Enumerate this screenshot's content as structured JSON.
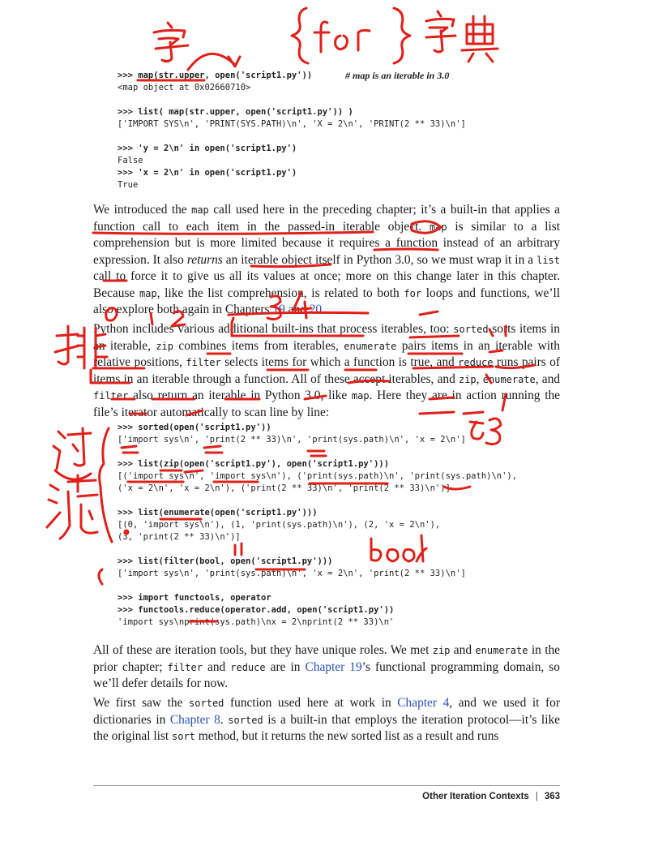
{
  "code_block_1": {
    "lines": [
      {
        "kind": "cmd",
        "text": ">>> map(str.upper, open('script1.py'))",
        "comment": "# map is an iterable in 3.0"
      },
      {
        "kind": "out",
        "text": "<map object at 0x02660710>"
      },
      {
        "kind": "gap"
      },
      {
        "kind": "cmd",
        "text": ">>> list( map(str.upper, open('script1.py')) )"
      },
      {
        "kind": "out",
        "text": "['IMPORT SYS\\n', 'PRINT(SYS.PATH)\\n', 'X = 2\\n', 'PRINT(2 ** 33)\\n']"
      },
      {
        "kind": "gap"
      },
      {
        "kind": "cmd",
        "text": ">>> 'y = 2\\n' in open('script1.py')"
      },
      {
        "kind": "out",
        "text": "False"
      },
      {
        "kind": "cmd",
        "text": ">>> 'x = 2\\n' in open('script1.py')"
      },
      {
        "kind": "out",
        "text": "True"
      }
    ]
  },
  "paragraph_1": [
    {
      "t": "text",
      "v": "We introduced the "
    },
    {
      "t": "mono",
      "v": "map"
    },
    {
      "t": "text",
      "v": " call used here in the preceding chapter; it’s a built-in that applies a function call to each item in the passed-in iterable object. "
    },
    {
      "t": "mono",
      "v": "map"
    },
    {
      "t": "text",
      "v": " is similar to a list comprehension but is more limited because it requires a function instead of an arbitrary expression. It also "
    },
    {
      "t": "em",
      "v": "returns"
    },
    {
      "t": "text",
      "v": " an iterable object itself in Python 3.0, so we must wrap it in a "
    },
    {
      "t": "mono",
      "v": "list"
    },
    {
      "t": "text",
      "v": " call to force it to give us all its values at once; more on this change later in this chapter. Because "
    },
    {
      "t": "mono",
      "v": "map"
    },
    {
      "t": "text",
      "v": ", like the list comprehension, is related to both "
    },
    {
      "t": "mono",
      "v": "for"
    },
    {
      "t": "text",
      "v": " loops and functions, we’ll also explore both again in Chapters "
    },
    {
      "t": "link",
      "v": "19"
    },
    {
      "t": "text",
      "v": " and "
    },
    {
      "t": "link",
      "v": "20"
    },
    {
      "t": "text",
      "v": "."
    }
  ],
  "paragraph_2": [
    {
      "t": "text",
      "v": "Python includes various additional built-ins that process iterables, too: "
    },
    {
      "t": "mono",
      "v": "sorted"
    },
    {
      "t": "text",
      "v": " sorts items in an iterable, "
    },
    {
      "t": "mono",
      "v": "zip"
    },
    {
      "t": "text",
      "v": " combines items from iterables, "
    },
    {
      "t": "mono",
      "v": "enumerate"
    },
    {
      "t": "text",
      "v": " pairs items in an iterable with relative positions, "
    },
    {
      "t": "mono",
      "v": "filter"
    },
    {
      "t": "text",
      "v": " selects items for which a function is true, and "
    },
    {
      "t": "mono",
      "v": "reduce"
    },
    {
      "t": "text",
      "v": " runs pairs of items in an iterable through a function. All of these accept iterables, and "
    },
    {
      "t": "mono",
      "v": "zip"
    },
    {
      "t": "text",
      "v": ", "
    },
    {
      "t": "mono",
      "v": "enumerate"
    },
    {
      "t": "text",
      "v": ", and "
    },
    {
      "t": "mono",
      "v": "filter"
    },
    {
      "t": "text",
      "v": " also return an iterable in Python 3.0, like "
    },
    {
      "t": "mono",
      "v": "map"
    },
    {
      "t": "text",
      "v": ". Here they are in action running the file’s iterator automatically to scan line by line:"
    }
  ],
  "code_block_2": {
    "lines": [
      {
        "kind": "cmd",
        "text": ">>> sorted(open('script1.py'))"
      },
      {
        "kind": "out",
        "text": "['import sys\\n', 'print(2 ** 33)\\n', 'print(sys.path)\\n', 'x = 2\\n']"
      },
      {
        "kind": "gap"
      },
      {
        "kind": "cmd",
        "text": ">>> list(zip(open('script1.py'), open('script1.py')))"
      },
      {
        "kind": "out",
        "text": "[('import sys\\n', 'import sys\\n'), ('print(sys.path)\\n', 'print(sys.path)\\n'),"
      },
      {
        "kind": "out",
        "text": "('x = 2\\n', 'x = 2\\n'), ('print(2 ** 33)\\n', 'print(2 ** 33)\\n')]"
      },
      {
        "kind": "gap"
      },
      {
        "kind": "cmd",
        "text": ">>> list(enumerate(open('script1.py')))"
      },
      {
        "kind": "out",
        "text": "[(0, 'import sys\\n'), (1, 'print(sys.path)\\n'), (2, 'x = 2\\n'),"
      },
      {
        "kind": "out",
        "text": "(3, 'print(2 ** 33)\\n')]"
      },
      {
        "kind": "gap"
      },
      {
        "kind": "cmd",
        "text": ">>> list(filter(bool, open('script1.py')))"
      },
      {
        "kind": "out",
        "text": "['import sys\\n', 'print(sys.path)\\n', 'x = 2\\n', 'print(2 ** 33)\\n']"
      },
      {
        "kind": "gap"
      },
      {
        "kind": "cmd",
        "text": ">>> import functools, operator"
      },
      {
        "kind": "cmd",
        "text": ">>> functools.reduce(operator.add, open('script1.py'))"
      },
      {
        "kind": "out",
        "text": "'import sys\\nprint(sys.path)\\nx = 2\\nprint(2 ** 33)\\n'"
      }
    ]
  },
  "paragraph_3": [
    {
      "t": "text",
      "v": "All of these are iteration tools, but they have unique roles. We met "
    },
    {
      "t": "mono",
      "v": "zip"
    },
    {
      "t": "text",
      "v": " and "
    },
    {
      "t": "mono",
      "v": "enumerate"
    },
    {
      "t": "text",
      "v": " in the prior chapter; "
    },
    {
      "t": "mono",
      "v": "filter"
    },
    {
      "t": "text",
      "v": " and "
    },
    {
      "t": "mono",
      "v": "reduce"
    },
    {
      "t": "text",
      "v": " are in "
    },
    {
      "t": "link",
      "v": "Chapter 19"
    },
    {
      "t": "text",
      "v": "’s functional programming domain, so we’ll defer details for now."
    }
  ],
  "paragraph_4": [
    {
      "t": "text",
      "v": "We first saw the "
    },
    {
      "t": "mono",
      "v": "sorted"
    },
    {
      "t": "text",
      "v": " function used here at work in "
    },
    {
      "t": "link",
      "v": "Chapter 4"
    },
    {
      "t": "text",
      "v": ", and we used it for dictionaries in "
    },
    {
      "t": "link",
      "v": "Chapter 8"
    },
    {
      "t": "text",
      "v": ". "
    },
    {
      "t": "mono",
      "v": "sorted"
    },
    {
      "t": "text",
      "v": " is a built-in that employs the iteration protocol—it’s like the original list "
    },
    {
      "t": "mono",
      "v": "sort"
    },
    {
      "t": "text",
      "v": " method, but it returns the new sorted list as a result and runs"
    }
  ],
  "footer": {
    "section_title": "Other Iteration Contexts",
    "separator": "|",
    "page_number": "363"
  },
  "annotations": {
    "ink_color": "#e0201a",
    "handwritten_texts": [
      "字",
      "{for}",
      "字典",
      "排",
      "过滤",
      "bool",
      "0",
      "1",
      "2",
      "3",
      "4",
      "11",
      "33"
    ]
  }
}
